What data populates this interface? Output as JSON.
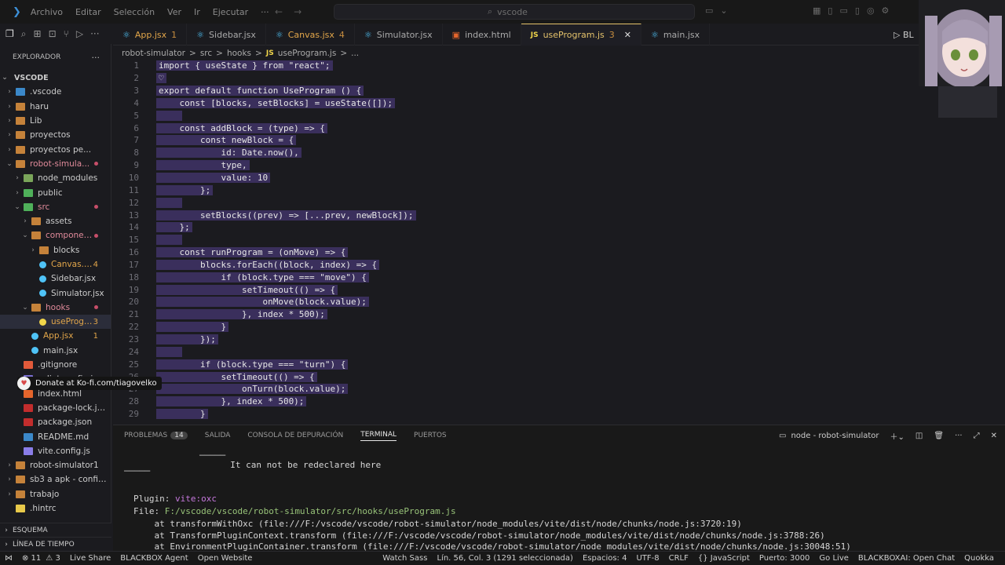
{
  "titlebar": {
    "menu": [
      "Archivo",
      "Editar",
      "Selección",
      "Ver",
      "Ir",
      "Ejecutar",
      "···"
    ],
    "search_text": "vscode",
    "nav_back": "←",
    "nav_forward": "→"
  },
  "sidebar": {
    "title": "EXPLORADOR",
    "more": "···",
    "root": "VSCODE",
    "items": [
      {
        "label": ".vscode",
        "indent": 0,
        "chev": "›",
        "icon": "vscode-folder-icon"
      },
      {
        "label": "haru",
        "indent": 0,
        "chev": "›",
        "icon": "folder-icon"
      },
      {
        "label": "Lib",
        "indent": 0,
        "chev": "›",
        "icon": "folder-icon"
      },
      {
        "label": "proyectos",
        "indent": 0,
        "chev": "›",
        "icon": "folder-icon"
      },
      {
        "label": "proyectos pe...",
        "indent": 0,
        "chev": "›",
        "icon": "folder-icon"
      },
      {
        "label": "robot-simula...",
        "indent": 0,
        "chev": "⌄",
        "icon": "folder-icon",
        "dot": true
      },
      {
        "label": "node_modules",
        "indent": 1,
        "chev": "›",
        "icon": "node-folder-icon"
      },
      {
        "label": "public",
        "indent": 1,
        "chev": "›",
        "icon": "public-folder-icon"
      },
      {
        "label": "src",
        "indent": 1,
        "chev": "⌄",
        "icon": "src-folder-icon",
        "dot": true
      },
      {
        "label": "assets",
        "indent": 2,
        "chev": "›",
        "icon": "folder-icon"
      },
      {
        "label": "components",
        "indent": 2,
        "chev": "⌄",
        "icon": "folder-icon",
        "dot": true
      },
      {
        "label": "blocks",
        "indent": 3,
        "chev": "›",
        "icon": "folder-icon"
      },
      {
        "label": "Canvas.jsx",
        "indent": 3,
        "chev": "",
        "icon": "react-icon",
        "count": "4",
        "warn": true
      },
      {
        "label": "Sidebar.jsx",
        "indent": 3,
        "chev": "",
        "icon": "react-icon"
      },
      {
        "label": "Simulator.jsx",
        "indent": 3,
        "chev": "",
        "icon": "react-icon"
      },
      {
        "label": "hooks",
        "indent": 2,
        "chev": "⌄",
        "icon": "folder-icon",
        "dot": true
      },
      {
        "label": "useProgr...",
        "indent": 3,
        "chev": "",
        "icon": "js-icon",
        "count": "3",
        "selected": true,
        "warn": true
      },
      {
        "label": "App.jsx",
        "indent": 2,
        "chev": "",
        "icon": "react-icon",
        "count": "1",
        "warn": true
      },
      {
        "label": "main.jsx",
        "indent": 2,
        "chev": "",
        "icon": "react-icon"
      },
      {
        "label": ".gitignore",
        "indent": 1,
        "chev": "",
        "icon": "git-icon"
      },
      {
        "label": "eslint.config.js",
        "indent": 1,
        "chev": "",
        "icon": "eslint-icon"
      },
      {
        "label": "index.html",
        "indent": 1,
        "chev": "",
        "icon": "html-icon"
      },
      {
        "label": "package-lock.json",
        "indent": 1,
        "chev": "",
        "icon": "npm-icon"
      },
      {
        "label": "package.json",
        "indent": 1,
        "chev": "",
        "icon": "npm-icon"
      },
      {
        "label": "README.md",
        "indent": 1,
        "chev": "",
        "icon": "readme-icon"
      },
      {
        "label": "vite.config.js",
        "indent": 1,
        "chev": "",
        "icon": "vite-icon"
      },
      {
        "label": "robot-simulator1",
        "indent": 0,
        "chev": "›",
        "icon": "folder-icon"
      },
      {
        "label": "sb3 a apk - config ...",
        "indent": 0,
        "chev": "›",
        "icon": "folder-icon"
      },
      {
        "label": "trabajo",
        "indent": 0,
        "chev": "›",
        "icon": "folder-icon"
      },
      {
        "label": ".hintrc",
        "indent": 0,
        "chev": "",
        "icon": "braces-icon"
      }
    ],
    "footer_outline": "ESQUEMA",
    "footer_timeline": "LÍNEA DE TIEMPO"
  },
  "tabs": [
    {
      "label": "App.jsx",
      "badge": "1",
      "icon": "react"
    },
    {
      "label": "Sidebar.jsx",
      "badge": "",
      "icon": "react"
    },
    {
      "label": "Canvas.jsx",
      "badge": "4",
      "icon": "react"
    },
    {
      "label": "Simulator.jsx",
      "badge": "",
      "icon": "react"
    },
    {
      "label": "index.html",
      "badge": "",
      "icon": "html"
    },
    {
      "label": "useProgram.js",
      "badge": "3",
      "icon": "js",
      "active": true
    },
    {
      "label": "main.jsx",
      "badge": "",
      "icon": "react"
    }
  ],
  "tab_run": "▷  BL",
  "breadcrumb": [
    "robot-simulator",
    ">",
    "src",
    ">",
    "hooks",
    ">",
    "JS",
    "useProgram.js",
    ">",
    "..."
  ],
  "code_lines": [
    {
      "n": "1",
      "t": "import { useState } from \"react\";"
    },
    {
      "n": "2",
      "t": "♡"
    },
    {
      "n": "3",
      "t": "export default function UseProgram () {"
    },
    {
      "n": "4",
      "t": "    const [blocks, setBlocks] = useState([]);"
    },
    {
      "n": "5",
      "t": "    "
    },
    {
      "n": "6",
      "t": "    const addBlock = (type) => {"
    },
    {
      "n": "7",
      "t": "        const newBlock = {"
    },
    {
      "n": "8",
      "t": "            id: Date.now(),"
    },
    {
      "n": "9",
      "t": "            type,"
    },
    {
      "n": "10",
      "t": "            value: 10"
    },
    {
      "n": "11",
      "t": "        };"
    },
    {
      "n": "12",
      "t": "    "
    },
    {
      "n": "13",
      "t": "        setBlocks((prev) => [...prev, newBlock]);"
    },
    {
      "n": "14",
      "t": "    };"
    },
    {
      "n": "15",
      "t": "    "
    },
    {
      "n": "16",
      "t": "    const runProgram = (onMove) => {"
    },
    {
      "n": "17",
      "t": "        blocks.forEach((block, index) => {"
    },
    {
      "n": "18",
      "t": "            if (block.type === \"move\") {"
    },
    {
      "n": "19",
      "t": "                setTimeout(() => {"
    },
    {
      "n": "20",
      "t": "                    onMove(block.value);"
    },
    {
      "n": "21",
      "t": "                }, index * 500);"
    },
    {
      "n": "22",
      "t": "            }"
    },
    {
      "n": "23",
      "t": "        });"
    },
    {
      "n": "24",
      "t": "    "
    },
    {
      "n": "25",
      "t": "        if (block.type === \"turn\") {"
    },
    {
      "n": "26",
      "t": "            setTimeout(() => {"
    },
    {
      "n": "27",
      "t": "                onTurn(block.value);"
    },
    {
      "n": "28",
      "t": "            }, index * 500);"
    },
    {
      "n": "29",
      "t": "        }"
    }
  ],
  "panel": {
    "tabs": [
      {
        "label": "PROBLEMAS",
        "count": "14"
      },
      {
        "label": "SALIDA"
      },
      {
        "label": "CONSOLA DE DEPURACIÓN"
      },
      {
        "label": "TERMINAL",
        "active": true
      },
      {
        "label": "PUERTOS"
      }
    ],
    "terminal_name": "node - robot-simulator",
    "terminal_lines": [
      {
        "text": "  It can not be redeclared here",
        "color": "#d6d6d6"
      },
      {
        "text": "Plugin: vite:oxc",
        "color": "#d6d6d6"
      },
      {
        "text": "File: F:/vscode/vscode/robot-simulator/src/hooks/useProgram.js",
        "color": "#d6d6d6"
      },
      {
        "text": "    at transformWithOxc (file:///F:/vscode/vscode/robot-simulator/node_modules/vite/dist/node/chunks/node.js:3720:19)",
        "color": "#d6d6d6"
      },
      {
        "text": "    at TransformPluginContext.transform (file:///F:/vscode/vscode/robot-simulator/node_modules/vite/dist/node/chunks/node.js:3788:26)",
        "color": "#d6d6d6"
      },
      {
        "text": "    at EnvironmentPluginContainer.transform (file:///F:/vscode/vscode/robot-simulator/node_modules/vite/dist/node/chunks/node.js:30048:51)",
        "color": "#d6d6d6"
      }
    ]
  },
  "donate": "Donate at Ko-fi.com/tiagovelko",
  "status": {
    "errors": "⊗ 11",
    "warnings": "⚠ 3",
    "live_share": "Live Share",
    "blackbox_agent": "BLACKBOX Agent",
    "open_website": "Open Website",
    "watch_sass": "Watch Sass",
    "position": "Lín. 56, Col. 3 (1291 seleccionada)",
    "spaces": "Espacios: 4",
    "encoding": "UTF-8",
    "eol": "CRLF",
    "language": "{} JavaScript",
    "port": "Puerto: 3000",
    "go_live": "Go Live",
    "blackbox_chat": "BLACKBOXAI: Open Chat",
    "quokka": "Quokka"
  }
}
